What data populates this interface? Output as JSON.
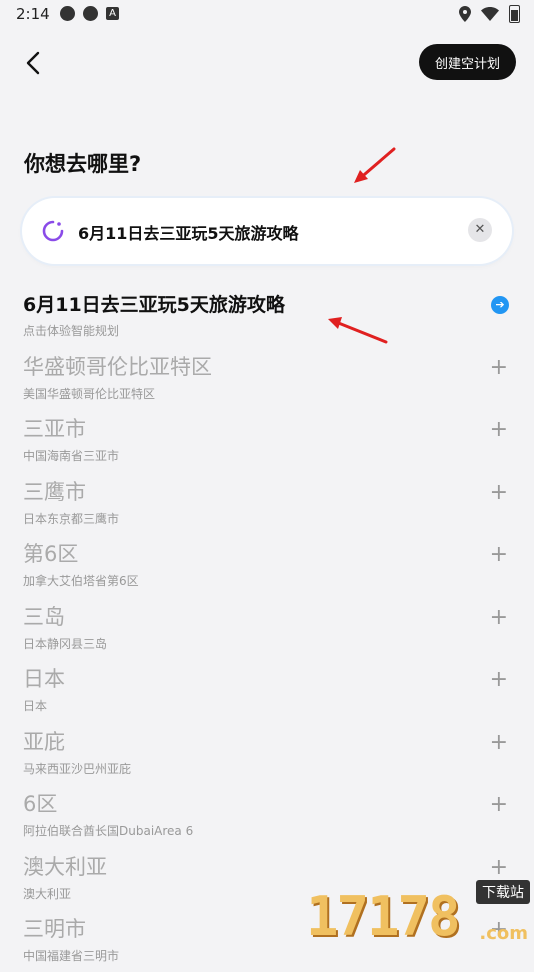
{
  "status_bar": {
    "time": "2:14"
  },
  "header": {
    "create_plan_label": "创建空计划"
  },
  "question": "你想去哪里?",
  "search": {
    "value": "6月11日去三亚玩5天旅游攻略"
  },
  "suggestions": [
    {
      "title": "6月11日去三亚玩5天旅游攻略",
      "subtitle": "点击体验智能规划"
    },
    {
      "title": "华盛顿哥伦比亚特区",
      "subtitle": "美国华盛顿哥伦比亚特区"
    },
    {
      "title": "三亚市",
      "subtitle": "中国海南省三亚市"
    },
    {
      "title": "三鹰市",
      "subtitle": "日本东京都三鹰市"
    },
    {
      "title": "第6区",
      "subtitle": "加拿大艾伯塔省第6区"
    },
    {
      "title": "三岛",
      "subtitle": "日本静冈县三岛"
    },
    {
      "title": "日本",
      "subtitle": "日本"
    },
    {
      "title": "亚庇",
      "subtitle": "马来西亚沙巴州亚庇"
    },
    {
      "title": "6区",
      "subtitle": "阿拉伯联合酋长国DubaiArea 6"
    },
    {
      "title": "澳大利亚",
      "subtitle": "澳大利亚"
    },
    {
      "title": "三明市",
      "subtitle": "中国福建省三明市"
    }
  ],
  "watermark": {
    "digits": "17178",
    "tag": "下载站",
    "domain": ".com"
  },
  "colors": {
    "accent": "#2196f3",
    "annotation_arrow": "#e02020",
    "button_bg": "#111111"
  }
}
